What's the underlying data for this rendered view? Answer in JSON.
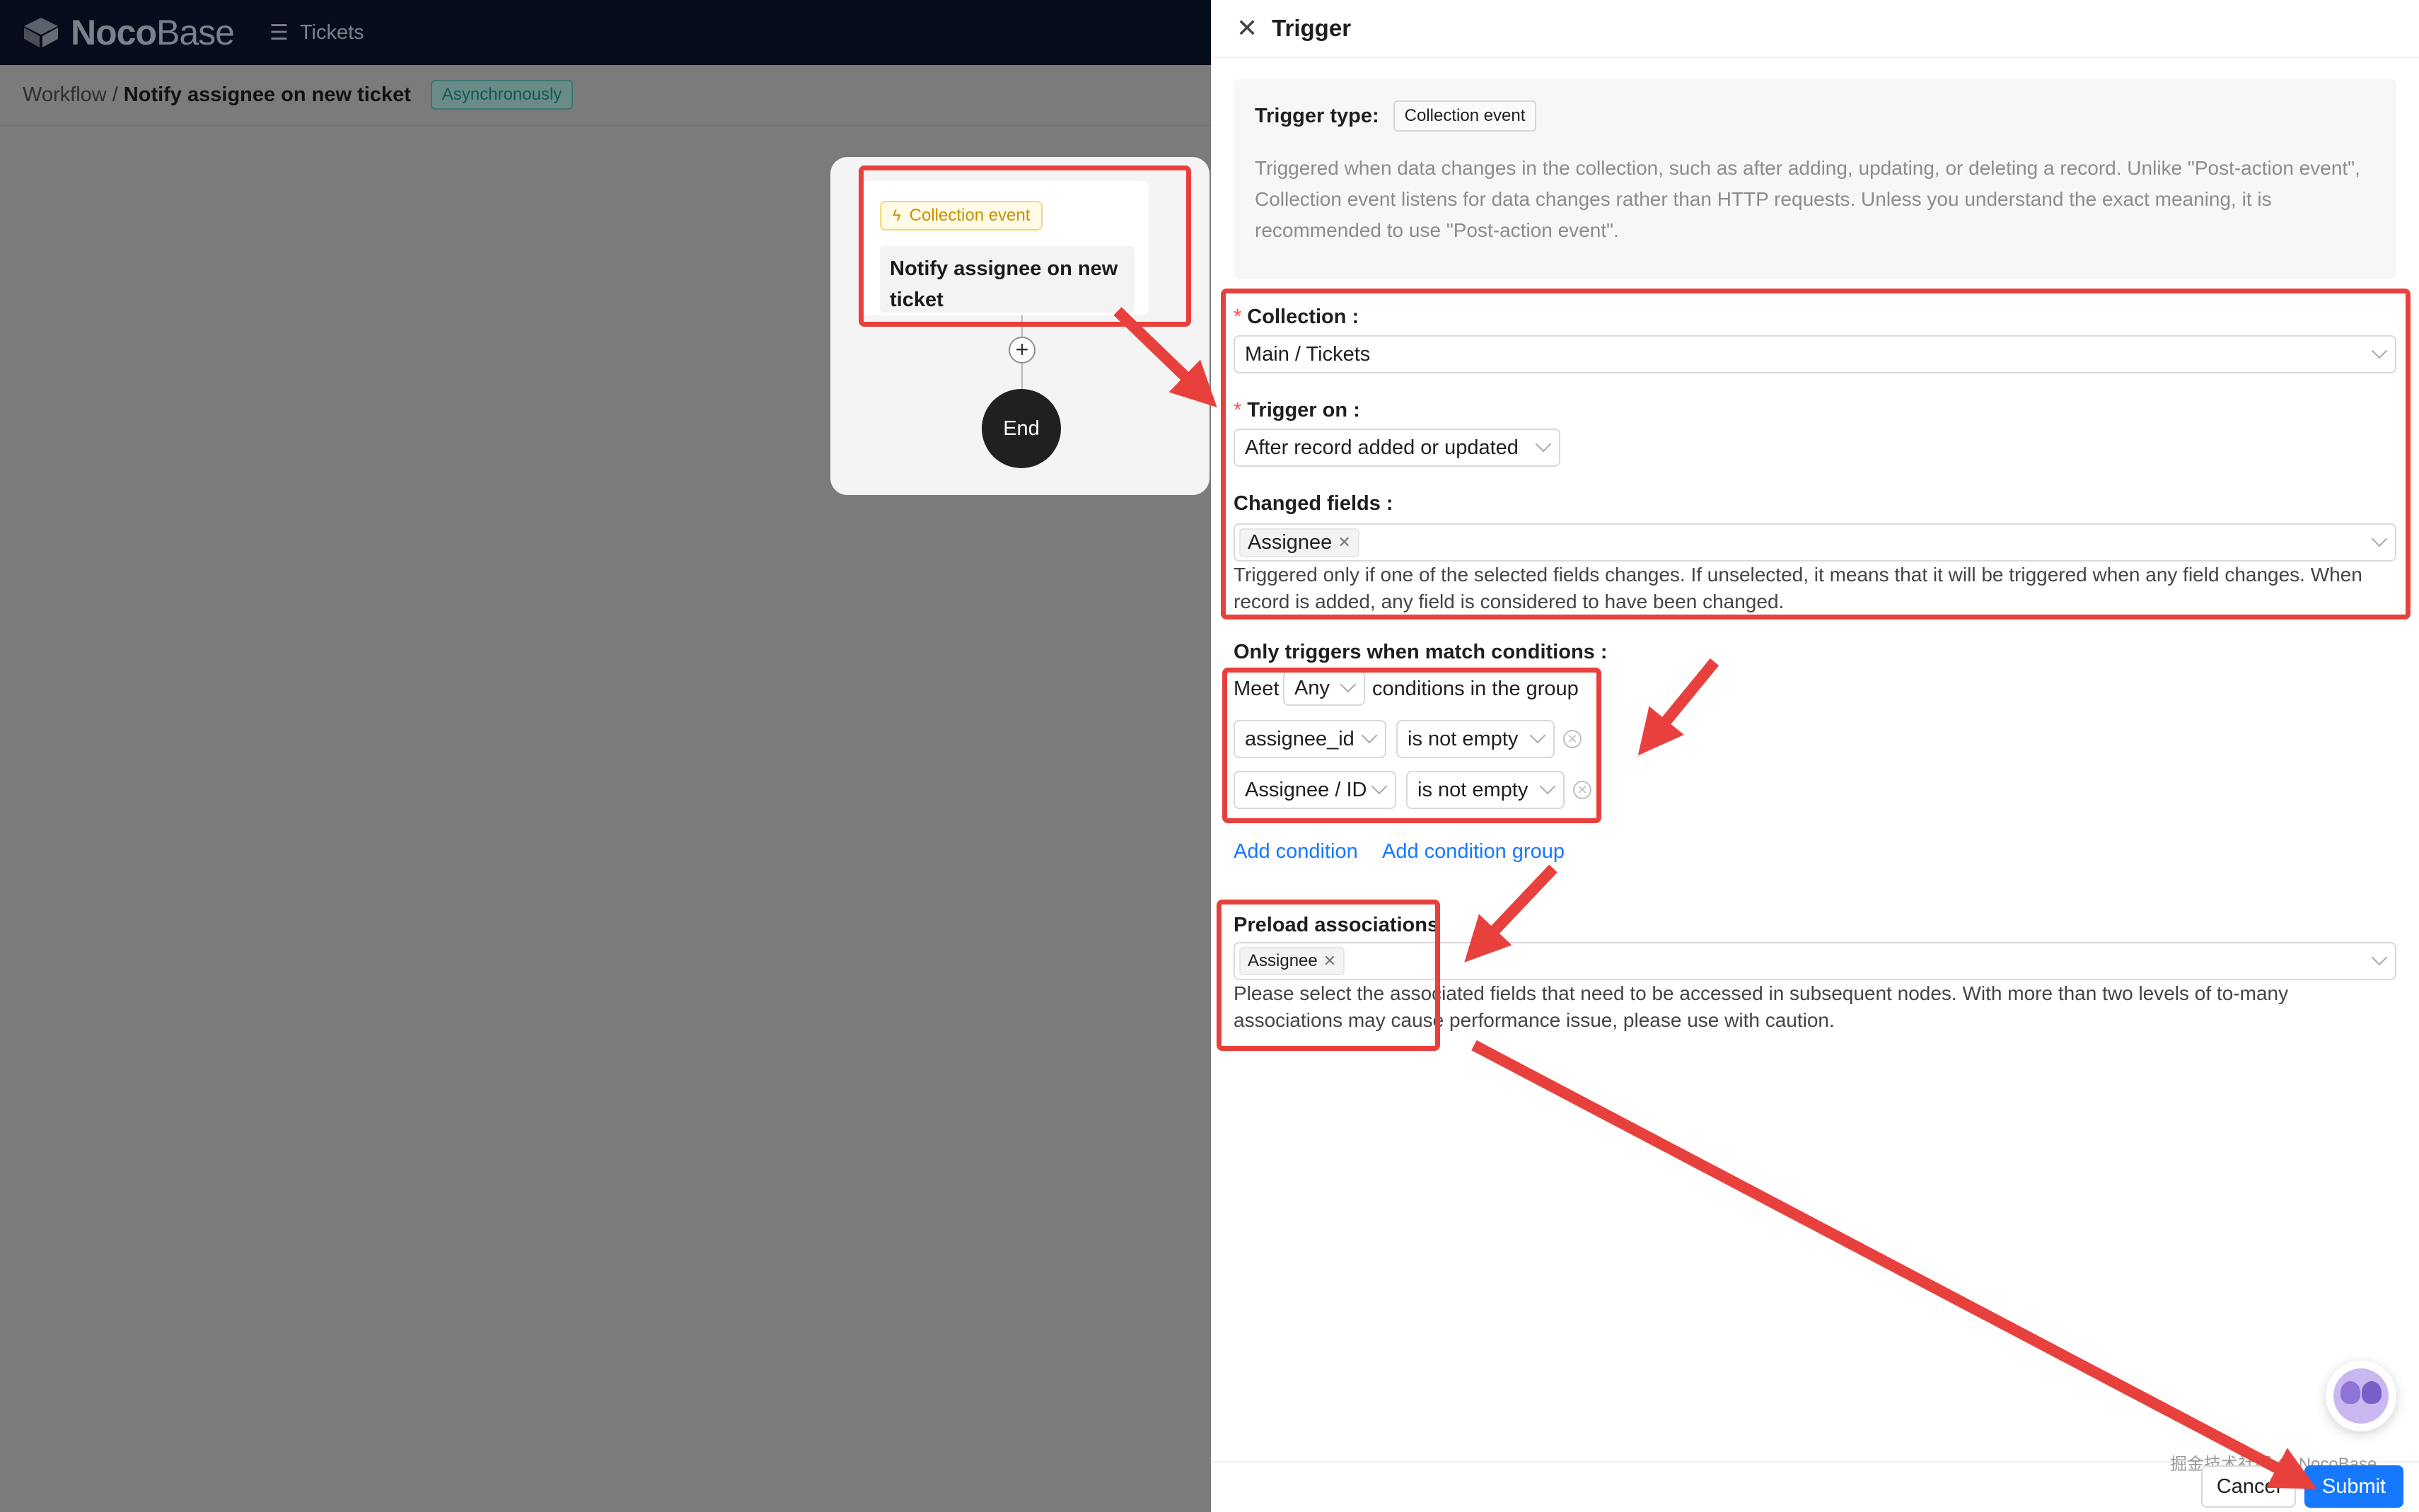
{
  "header": {
    "logo_bold": "Noco",
    "logo_thin": "Base",
    "menu_label": "Tickets"
  },
  "breadcrumb": {
    "parent": "Workflow",
    "separator": "/",
    "current": "Notify assignee on new ticket",
    "mode_tag": "Asynchronously"
  },
  "flow": {
    "trigger_tag": "Collection event",
    "trigger_title": "Notify assignee on new ticket",
    "add_symbol": "+",
    "end_label": "End"
  },
  "drawer": {
    "title": "Trigger",
    "trigger_type_label": "Trigger type:",
    "trigger_type_value": "Collection event",
    "trigger_desc": "Triggered when data changes in the collection, such as after adding, updating, or deleting a record. Unlike \"Post-action event\", Collection event listens for data changes rather than HTTP requests. Unless you understand the exact meaning, it is recommended to use \"Post-action event\".",
    "collection_label": "Collection :",
    "collection_value": "Main / Tickets",
    "trigger_on_label": "Trigger on :",
    "trigger_on_value": "After record added or updated",
    "changed_fields_label": "Changed fields :",
    "changed_fields_chip": "Assignee",
    "changed_fields_help": "Triggered only if one of the selected fields changes. If unselected, it means that it will be triggered when any field changes. When record is added, any field is considered to have been changed.",
    "conditions_label": "Only triggers when match conditions :",
    "meet_label": "Meet",
    "meet_value": "Any",
    "group_suffix": "conditions in the group",
    "conditions": [
      {
        "field": "assignee_id",
        "operator": "is not empty"
      },
      {
        "field": "Assignee / ID",
        "operator": "is not empty"
      }
    ],
    "add_condition": "Add condition",
    "add_condition_group": "Add condition group",
    "preload_label": "Preload associations",
    "preload_chip": "Assignee",
    "preload_help": "Please select the associated fields that need to be accessed in subsequent nodes. With more than two levels of to-many associations may cause performance issue, please use with caution.",
    "cancel": "Cancel",
    "submit": "Submit"
  },
  "watermark": "掘金技术社区 @ NocoBase",
  "colors": {
    "primary": "#1677ff",
    "annotation": "#e8413d",
    "required": "#ff4d4f",
    "warning_tag": "#c69100"
  },
  "icons": [
    "close-icon",
    "menu-icon",
    "bolt-icon",
    "chevron-down-icon",
    "clear-icon",
    "plus-icon",
    "avatar-icon"
  ]
}
